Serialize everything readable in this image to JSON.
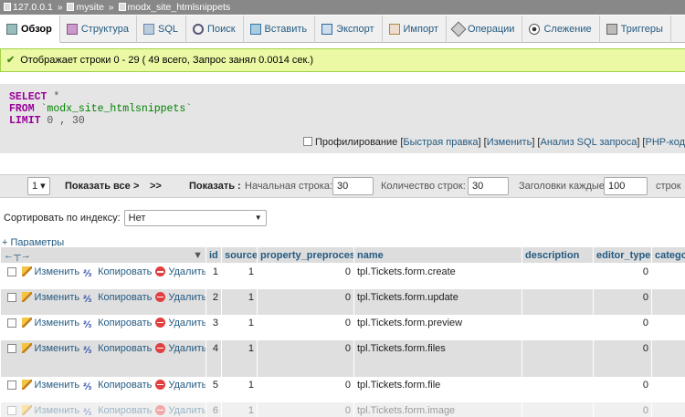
{
  "breadcrumb": {
    "server": "127.0.0.1",
    "db": "mysite",
    "table": "modx_site_htmlsnippets",
    "sep": "»"
  },
  "tabs": [
    {
      "label": "Обзор",
      "icon": "browse-icon"
    },
    {
      "label": "Структура",
      "icon": "structure-icon"
    },
    {
      "label": "SQL",
      "icon": "sql-icon"
    },
    {
      "label": "Поиск",
      "icon": "search-icon"
    },
    {
      "label": "Вставить",
      "icon": "insert-icon"
    },
    {
      "label": "Экспорт",
      "icon": "export-icon"
    },
    {
      "label": "Импорт",
      "icon": "import-icon"
    },
    {
      "label": "Операции",
      "icon": "wrench-icon"
    },
    {
      "label": "Слежение",
      "icon": "eye-icon"
    },
    {
      "label": "Триггеры",
      "icon": "triggers-icon"
    }
  ],
  "success": {
    "message": "Отображает строки 0 - 29 ( 49 всего, Запрос занял 0.0014 сек.)"
  },
  "sql": {
    "select": "SELECT",
    "star": "*",
    "from": "FROM",
    "table": "`modx_site_htmlsnippets`",
    "limit": "LIMIT",
    "limit_val": "0 , 30"
  },
  "sql_options": {
    "profiling": "Профилирование",
    "quick_edit": "Быстрая правка",
    "edit": "Изменить",
    "analyze": "Анализ SQL запроса",
    "php": "PHP-код"
  },
  "nav": {
    "page": "1",
    "show_all": "Показать все",
    "next": ">",
    "last": ">>",
    "show": "Показать :",
    "start_label": "Начальная строка:",
    "start_val": "30",
    "count_label": "Количество строк:",
    "count_val": "30",
    "headers_label": "Заголовки каждые",
    "headers_val": "100",
    "rows_suffix": "строк"
  },
  "sort": {
    "label": "Сортировать по индексу:",
    "value": "Нет"
  },
  "params": "+ Параметры",
  "columns": [
    "id",
    "source",
    "property_preprocess",
    "name",
    "description",
    "editor_type",
    "category"
  ],
  "actions": {
    "edit": "Изменить",
    "copy": "Копировать",
    "delete": "Удалить"
  },
  "rows": [
    {
      "id": "1",
      "source": "1",
      "pp": "0",
      "name": "tpl.Tickets.form.create",
      "editor_type": "0"
    },
    {
      "id": "2",
      "source": "1",
      "pp": "0",
      "name": "tpl.Tickets.form.update",
      "editor_type": "0"
    },
    {
      "id": "3",
      "source": "1",
      "pp": "0",
      "name": "tpl.Tickets.form.preview",
      "editor_type": "0"
    },
    {
      "id": "4",
      "source": "1",
      "pp": "0",
      "name": "tpl.Tickets.form.files",
      "editor_type": "0"
    },
    {
      "id": "5",
      "source": "1",
      "pp": "0",
      "name": "tpl.Tickets.form.file",
      "editor_type": "0"
    },
    {
      "id": "6",
      "source": "1",
      "pp": "0",
      "name": "tpl.Tickets.form.image",
      "editor_type": "0"
    }
  ]
}
